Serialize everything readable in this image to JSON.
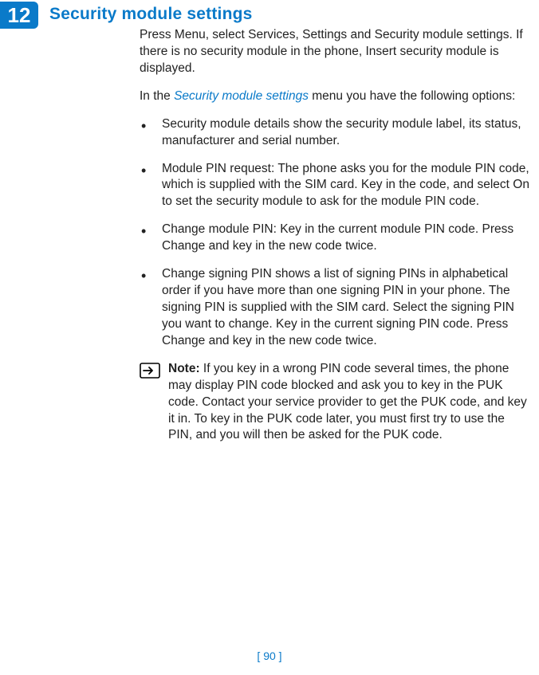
{
  "chapter_number": "12",
  "heading": "Security module settings",
  "intro1": "Press Menu, select Services, Settings and Security module settings. If there is no security module in the phone, Insert security module is displayed.",
  "intro2_prefix": "In the ",
  "intro2_link": "Security module settings",
  "intro2_suffix": " menu you have the following options:",
  "bullets": [
    "Security module details show the security module label, its status, manufacturer and serial number.",
    "Module PIN request: The phone asks you for the module PIN code, which is supplied with the SIM card. Key in the code, and select On to set the security module to ask for the module PIN code.",
    "Change module PIN: Key in the current module PIN code. Press Change and key in the new code twice.",
    "Change signing PIN shows a list of signing PINs in alphabetical order if you have more than one signing PIN in your phone. The signing PIN is supplied with the SIM card. Select the signing PIN you want to change. Key in the current signing PIN code. Press Change and key in the new code twice."
  ],
  "note_label": "Note:",
  "note_text": " If you key in a wrong PIN code several times, the phone may display PIN code blocked and ask you to key in the PUK code. Contact your service provider to get the PUK code, and key it in. To key in the PUK code later, you must first try to use the PIN, and you will then be asked for the PUK code.",
  "page_number": "[ 90 ]"
}
